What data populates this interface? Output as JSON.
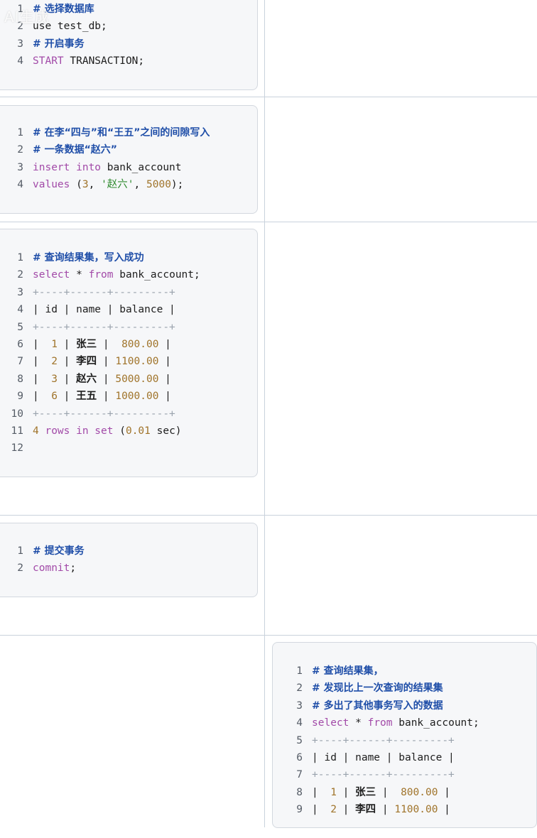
{
  "watermark": "AI生成",
  "blocks": [
    {
      "id": "select-db",
      "lines": [
        {
          "n": "1",
          "parts": [
            {
              "t": "# 选择数据库",
              "c": "cm"
            }
          ]
        },
        {
          "n": "2",
          "parts": [
            {
              "t": "use test_db;",
              "c": "pl"
            }
          ]
        },
        {
          "n": "3",
          "parts": [
            {
              "t": "# 开启事务",
              "c": "cm"
            }
          ]
        },
        {
          "n": "4",
          "parts": [
            {
              "t": "START",
              "c": "kw"
            },
            {
              "t": " TRANSACTION;",
              "c": "pl"
            }
          ]
        }
      ]
    },
    {
      "id": "insert-gap",
      "lines": [
        {
          "n": "1",
          "parts": [
            {
              "t": "# 在李“四与”和“王五”之间的间隙写入",
              "c": "cm"
            }
          ]
        },
        {
          "n": "2",
          "parts": [
            {
              "t": "# 一条数据“赵六”",
              "c": "cm"
            }
          ]
        },
        {
          "n": "3",
          "parts": [
            {
              "t": "insert into",
              "c": "kw"
            },
            {
              "t": " bank_account",
              "c": "pl"
            }
          ]
        },
        {
          "n": "4",
          "parts": [
            {
              "t": "values",
              "c": "kw"
            },
            {
              "t": " (",
              "c": "pl"
            },
            {
              "t": "3",
              "c": "num"
            },
            {
              "t": ", ",
              "c": "pl"
            },
            {
              "t": "'赵六'",
              "c": "str"
            },
            {
              "t": ", ",
              "c": "pl"
            },
            {
              "t": "5000",
              "c": "num"
            },
            {
              "t": ");",
              "c": "pl"
            }
          ]
        }
      ]
    },
    {
      "id": "query-1",
      "lines": [
        {
          "n": "1",
          "parts": [
            {
              "t": "# 查询结果集，写入成功",
              "c": "cm"
            }
          ]
        },
        {
          "n": "2",
          "parts": [
            {
              "t": "select",
              "c": "kw"
            },
            {
              "t": " * ",
              "c": "pl"
            },
            {
              "t": "from",
              "c": "kw"
            },
            {
              "t": " bank_account;",
              "c": "pl"
            }
          ]
        },
        {
          "n": "3",
          "parts": [
            {
              "t": "+----+------+---------+",
              "c": "bd"
            }
          ]
        },
        {
          "n": "4",
          "parts": [
            {
              "t": "| id | name | balance |",
              "c": "pl"
            }
          ]
        },
        {
          "n": "5",
          "parts": [
            {
              "t": "+----+------+---------+",
              "c": "bd"
            }
          ]
        },
        {
          "n": "6",
          "parts": [
            {
              "t": "|  ",
              "c": "pl"
            },
            {
              "t": "1",
              "c": "num"
            },
            {
              "t": " | ",
              "c": "pl"
            },
            {
              "t": "张三",
              "c": "cn"
            },
            {
              "t": " |  ",
              "c": "pl"
            },
            {
              "t": "800.00",
              "c": "num"
            },
            {
              "t": " |",
              "c": "pl"
            }
          ]
        },
        {
          "n": "7",
          "parts": [
            {
              "t": "|  ",
              "c": "pl"
            },
            {
              "t": "2",
              "c": "num"
            },
            {
              "t": " | ",
              "c": "pl"
            },
            {
              "t": "李四",
              "c": "cn"
            },
            {
              "t": " | ",
              "c": "pl"
            },
            {
              "t": "1100.00",
              "c": "num"
            },
            {
              "t": " |",
              "c": "pl"
            }
          ]
        },
        {
          "n": "8",
          "parts": [
            {
              "t": "|  ",
              "c": "pl"
            },
            {
              "t": "3",
              "c": "num"
            },
            {
              "t": " | ",
              "c": "pl"
            },
            {
              "t": "赵六",
              "c": "cn"
            },
            {
              "t": " | ",
              "c": "pl"
            },
            {
              "t": "5000.00",
              "c": "num"
            },
            {
              "t": " |",
              "c": "pl"
            }
          ]
        },
        {
          "n": "9",
          "parts": [
            {
              "t": "|  ",
              "c": "pl"
            },
            {
              "t": "6",
              "c": "num"
            },
            {
              "t": " | ",
              "c": "pl"
            },
            {
              "t": "王五",
              "c": "cn"
            },
            {
              "t": " | ",
              "c": "pl"
            },
            {
              "t": "1000.00",
              "c": "num"
            },
            {
              "t": " |",
              "c": "pl"
            }
          ]
        },
        {
          "n": "10",
          "parts": [
            {
              "t": "+----+------+---------+",
              "c": "bd"
            }
          ]
        },
        {
          "n": "11",
          "parts": [
            {
              "t": "4",
              "c": "num"
            },
            {
              "t": " rows in set",
              "c": "kw"
            },
            {
              "t": " (",
              "c": "pl"
            },
            {
              "t": "0.01",
              "c": "num"
            },
            {
              "t": " sec)",
              "c": "pl"
            }
          ]
        },
        {
          "n": "12",
          "parts": []
        }
      ]
    },
    {
      "id": "commit",
      "lines": [
        {
          "n": "1",
          "parts": [
            {
              "t": "# 提交事务",
              "c": "cm"
            }
          ]
        },
        {
          "n": "2",
          "parts": [
            {
              "t": "comnit",
              "c": "kw"
            },
            {
              "t": ";",
              "c": "pl"
            }
          ]
        }
      ]
    },
    {
      "id": "query-2",
      "lines": [
        {
          "n": "1",
          "parts": [
            {
              "t": "# 查询结果集，",
              "c": "cm"
            }
          ]
        },
        {
          "n": "2",
          "parts": [
            {
              "t": "# 发现比上一次查询的结果集",
              "c": "cm"
            }
          ]
        },
        {
          "n": "3",
          "parts": [
            {
              "t": "# 多出了其他事务写入的数据",
              "c": "cm"
            }
          ]
        },
        {
          "n": "4",
          "parts": [
            {
              "t": "select",
              "c": "kw"
            },
            {
              "t": " * ",
              "c": "pl"
            },
            {
              "t": "from",
              "c": "kw"
            },
            {
              "t": " bank_account;",
              "c": "pl"
            }
          ]
        },
        {
          "n": "5",
          "parts": [
            {
              "t": "+----+------+---------+",
              "c": "bd"
            }
          ]
        },
        {
          "n": "6",
          "parts": [
            {
              "t": "| id | name | balance |",
              "c": "pl"
            }
          ]
        },
        {
          "n": "7",
          "parts": [
            {
              "t": "+----+------+---------+",
              "c": "bd"
            }
          ]
        },
        {
          "n": "8",
          "parts": [
            {
              "t": "|  ",
              "c": "pl"
            },
            {
              "t": "1",
              "c": "num"
            },
            {
              "t": " | ",
              "c": "pl"
            },
            {
              "t": "张三",
              "c": "cn"
            },
            {
              "t": " |  ",
              "c": "pl"
            },
            {
              "t": "800.00",
              "c": "num"
            },
            {
              "t": " |",
              "c": "pl"
            }
          ]
        },
        {
          "n": "9",
          "parts": [
            {
              "t": "|  ",
              "c": "pl"
            },
            {
              "t": "2",
              "c": "num"
            },
            {
              "t": " | ",
              "c": "pl"
            },
            {
              "t": "李四",
              "c": "cn"
            },
            {
              "t": " | ",
              "c": "pl"
            },
            {
              "t": "1100.00",
              "c": "num"
            },
            {
              "t": " |",
              "c": "pl"
            }
          ]
        }
      ]
    }
  ]
}
